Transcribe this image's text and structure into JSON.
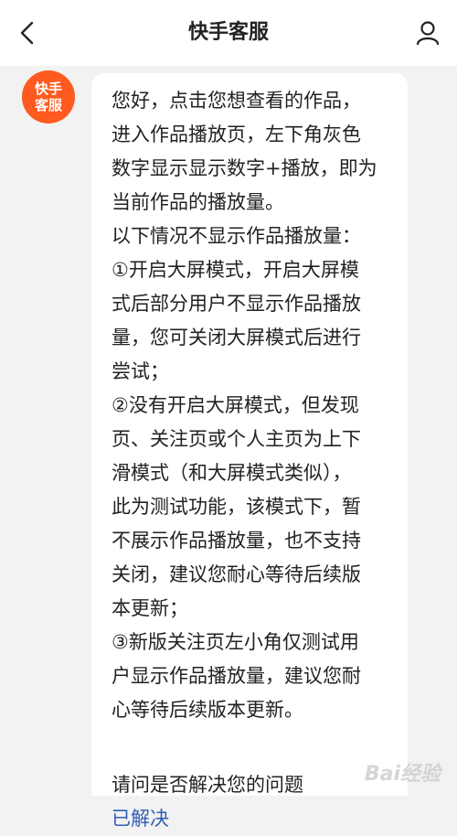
{
  "header": {
    "title": "快手客服",
    "back_icon": "chevron-left-icon",
    "profile_icon": "user-icon"
  },
  "avatar": {
    "line1": "快手",
    "line2": "客服",
    "color": "#ff5a1f"
  },
  "message": {
    "lines": [
      "您好，点击您想查看的作品，",
      "进入作品播放页，左下角灰色",
      "数字显示显示数字+播放，即为",
      "当前作品的播放量。",
      "以下情况不显示作品播放量：",
      "①开启大屏模式，开启大屏模",
      "式后部分用户不显示作品播放",
      "量，您可关闭大屏模式后进行",
      "尝试；",
      "②没有开启大屏模式，但发现",
      "页、关注页或个人主页为上下",
      "滑模式（和大屏模式类似），",
      "此为测试功能，该模式下，暂",
      "不展示作品播放量，也不支持",
      "关闭，建议您耐心等待后续版",
      "本更新；",
      "③新版关注页左小角仅测试用",
      "户显示作品播放量，建议您耐",
      "心等待后续版本更新。"
    ],
    "question": "请问是否解决您的问题",
    "resolved_link": "已解决"
  },
  "watermark": "Bai经验"
}
